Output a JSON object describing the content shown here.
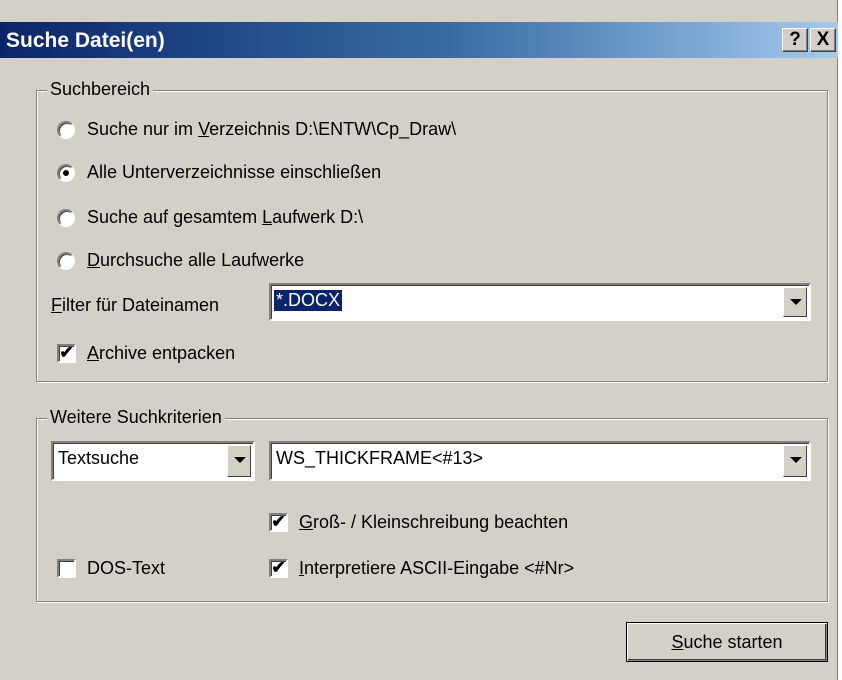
{
  "window": {
    "title": "Suche Datei(en)",
    "help_label": "?",
    "close_label": "X"
  },
  "search_area": {
    "legend": "Suchbereich",
    "options": [
      {
        "prefix": "Suche nur im ",
        "underline": "V",
        "suffix": "erzeichnis D:\\ENTW\\Cp_Draw\\",
        "selected": false
      },
      {
        "prefix": "Alle Unterverzeichnisse einschließen",
        "underline": "",
        "suffix": "",
        "selected": true
      },
      {
        "prefix": "Suche auf gesamtem ",
        "underline": "L",
        "suffix": "aufwerk D:\\",
        "selected": false
      },
      {
        "prefix": "",
        "underline": "D",
        "suffix": "urchsuche alle Laufwerke",
        "selected": false
      }
    ],
    "filter_label_underline": "F",
    "filter_label_rest": "ilter für Dateinamen",
    "filter_value": "*.DOCX",
    "archive_underline": "A",
    "archive_rest": "rchive entpacken",
    "archive_checked": "✔"
  },
  "criteria": {
    "legend": "Weitere Suchkriterien",
    "type_value": "Textsuche",
    "text_value": "WS_THICKFRAME<#13>",
    "case_underline": "G",
    "case_rest": "roß- / Kleinschreibung beachten",
    "case_checked": "✔",
    "ascii_underline": "I",
    "ascii_rest": "nterpretiere ASCII-Eingabe <#Nr>",
    "ascii_checked": "✔",
    "dos_label": "DOS-Text",
    "dos_checked": ""
  },
  "actions": {
    "start_underline": "S",
    "start_rest": "uche starten"
  }
}
